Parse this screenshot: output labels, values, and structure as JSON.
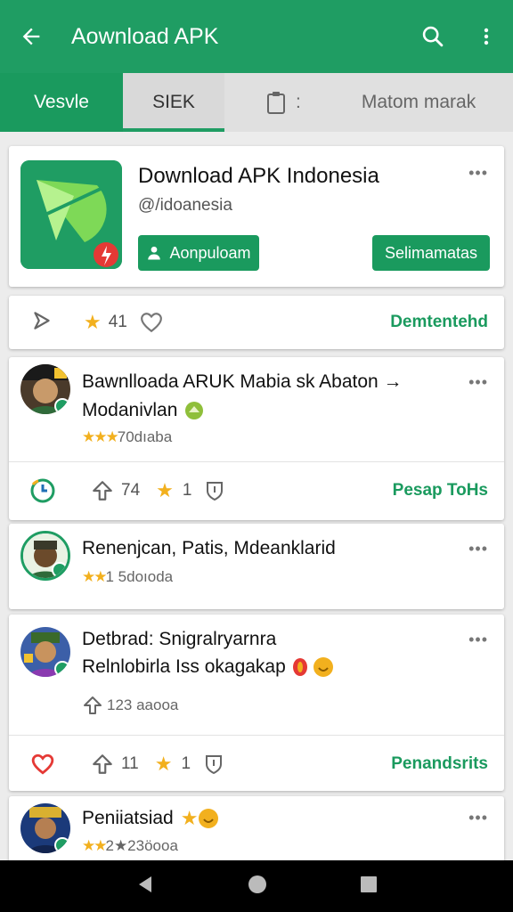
{
  "appbar": {
    "title": "Aownload APK"
  },
  "tabs": [
    {
      "label": "Vesvle"
    },
    {
      "label": "SIEK"
    },
    {
      "label": "Matom marak"
    }
  ],
  "hero": {
    "name": "Download APK Indonesia",
    "handle": "@/idoanesia",
    "more": "•••",
    "primary_button": "Aonpuloam",
    "secondary_button": "Selimamatas"
  },
  "stats": {
    "count": "41",
    "right_label": "Demtentehd"
  },
  "posts": [
    {
      "line1": "Bawnlloada ARUK Mabia sk Abaton →",
      "line2": "Modanivlan",
      "stars": "★★★",
      "meta": "70dıaba",
      "more": "•••",
      "actions": {
        "up_count": "74",
        "star_count": "1",
        "right_label": "Pesap ToHs"
      }
    },
    {
      "line1": "Renenjcan, Patis, Mdeanklarid",
      "stars": "★★",
      "meta": "1 5doıoda",
      "more": "•••"
    },
    {
      "line1": "Detbrad: Snigralryarnra",
      "line2": "Relnlobirla Iss okagakap",
      "meta": "123 aaooa",
      "more": "•••",
      "actions": {
        "up_count": "11",
        "star_count": "1",
        "right_label": "Penandsrits"
      }
    },
    {
      "line1": "Peniiatsiad",
      "stars": "★★",
      "meta": "2★23öooa",
      "more": "•••"
    }
  ],
  "colors": {
    "brand": "#1f9d63",
    "accent_star": "#f2b01e"
  }
}
